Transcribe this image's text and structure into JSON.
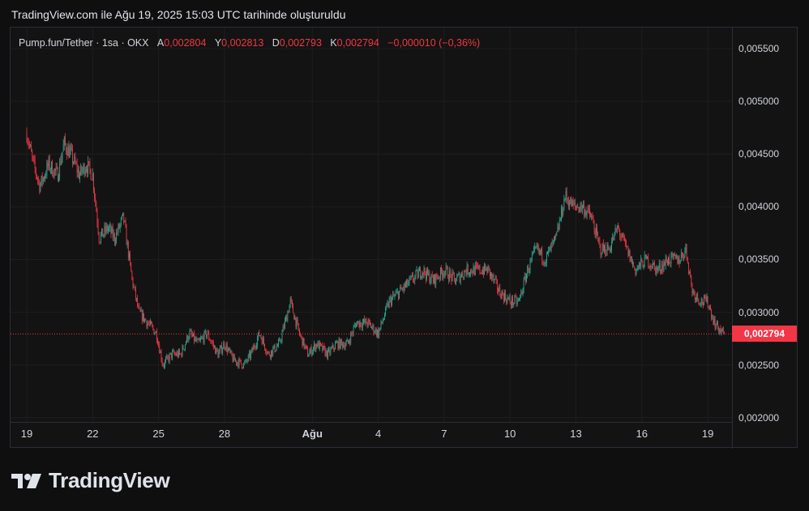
{
  "header": {
    "text": "TradingView.com ile Ağu 19, 2025 15:03 UTC tarihinde oluşturuldu"
  },
  "legend": {
    "symbol": "Pump.fun/Tether · 1sa · OKX",
    "open_label": "A",
    "open": "0,002804",
    "high_label": "Y",
    "high": "0,002813",
    "low_label": "D",
    "low": "0,002793",
    "close_label": "K",
    "close": "0,002794",
    "change": "−0,000010 (−0,36%)"
  },
  "price_tag": "0,002794",
  "logo": {
    "text": "TradingView",
    "icon": "tradingview-logo-icon"
  },
  "colors": {
    "up": "#22ab94",
    "down": "#f23645",
    "background": "#131313",
    "text": "#d1d4dc"
  },
  "chart_data": {
    "type": "candlestick",
    "symbol": "Pump.fun/Tether",
    "interval": "1sa",
    "exchange": "OKX",
    "last_price": 0.002794,
    "ylim": [
      0.00196,
      0.0057
    ],
    "y_ticks": [
      0.0055,
      0.005,
      0.0045,
      0.004,
      0.0035,
      0.003,
      0.0025,
      0.002
    ],
    "y_tick_labels": [
      "0,005500",
      "0,005000",
      "0,004500",
      "0,004000",
      "0,003500",
      "0,003000",
      "0,002500",
      "0,002000"
    ],
    "x_ticks": [
      {
        "label": "19",
        "day": 0,
        "bold": false
      },
      {
        "label": "22",
        "day": 3,
        "bold": false
      },
      {
        "label": "25",
        "day": 6,
        "bold": false
      },
      {
        "label": "28",
        "day": 9,
        "bold": false
      },
      {
        "label": "Ağu",
        "day": 13,
        "bold": true
      },
      {
        "label": "4",
        "day": 16,
        "bold": false
      },
      {
        "label": "7",
        "day": 19,
        "bold": false
      },
      {
        "label": "10",
        "day": 22,
        "bold": false
      },
      {
        "label": "13",
        "day": 25,
        "bold": false
      },
      {
        "label": "16",
        "day": 28,
        "bold": false
      },
      {
        "label": "19",
        "day": 31,
        "bold": false
      }
    ],
    "close_path": [
      [
        0.0,
        0.0047
      ],
      [
        0.3,
        0.0044
      ],
      [
        0.6,
        0.0042
      ],
      [
        1.0,
        0.0044
      ],
      [
        1.4,
        0.0043
      ],
      [
        1.7,
        0.0046
      ],
      [
        2.0,
        0.0045
      ],
      [
        2.4,
        0.0043
      ],
      [
        2.7,
        0.0044
      ],
      [
        3.0,
        0.0043
      ],
      [
        3.3,
        0.0037
      ],
      [
        3.7,
        0.0038
      ],
      [
        4.0,
        0.0037
      ],
      [
        4.4,
        0.0039
      ],
      [
        4.8,
        0.0033
      ],
      [
        5.1,
        0.003
      ],
      [
        5.5,
        0.0029
      ],
      [
        5.9,
        0.0028
      ],
      [
        6.2,
        0.0025
      ],
      [
        6.6,
        0.0026
      ],
      [
        7.0,
        0.0026
      ],
      [
        7.4,
        0.0028
      ],
      [
        7.8,
        0.0027
      ],
      [
        8.2,
        0.0028
      ],
      [
        8.7,
        0.0026
      ],
      [
        9.0,
        0.0027
      ],
      [
        9.4,
        0.00255
      ],
      [
        9.9,
        0.0025
      ],
      [
        10.2,
        0.0026
      ],
      [
        10.6,
        0.0028
      ],
      [
        11.0,
        0.0026
      ],
      [
        11.5,
        0.0027
      ],
      [
        12.0,
        0.0031
      ],
      [
        12.4,
        0.0028
      ],
      [
        12.8,
        0.0026
      ],
      [
        13.2,
        0.0027
      ],
      [
        13.7,
        0.0026
      ],
      [
        14.1,
        0.0027
      ],
      [
        14.6,
        0.0027
      ],
      [
        15.0,
        0.0029
      ],
      [
        15.5,
        0.0029
      ],
      [
        16.0,
        0.0028
      ],
      [
        16.5,
        0.0031
      ],
      [
        17.0,
        0.0032
      ],
      [
        17.5,
        0.0033
      ],
      [
        18.0,
        0.0034
      ],
      [
        18.5,
        0.0033
      ],
      [
        19.0,
        0.0034
      ],
      [
        19.5,
        0.0033
      ],
      [
        20.0,
        0.0034
      ],
      [
        20.5,
        0.0034
      ],
      [
        21.0,
        0.0034
      ],
      [
        21.5,
        0.0032
      ],
      [
        22.0,
        0.0031
      ],
      [
        22.4,
        0.0031
      ],
      [
        22.8,
        0.0034
      ],
      [
        23.2,
        0.0036
      ],
      [
        23.6,
        0.0035
      ],
      [
        24.1,
        0.0037
      ],
      [
        24.5,
        0.0041
      ],
      [
        24.9,
        0.004
      ],
      [
        25.3,
        0.004
      ],
      [
        25.7,
        0.0039
      ],
      [
        26.1,
        0.0036
      ],
      [
        26.5,
        0.0036
      ],
      [
        26.9,
        0.0038
      ],
      [
        27.3,
        0.0036
      ],
      [
        27.7,
        0.0034
      ],
      [
        28.2,
        0.0035
      ],
      [
        28.7,
        0.0034
      ],
      [
        29.2,
        0.0035
      ],
      [
        29.7,
        0.0035
      ],
      [
        30.0,
        0.0036
      ],
      [
        30.3,
        0.0032
      ],
      [
        30.7,
        0.0031
      ],
      [
        31.0,
        0.0031
      ],
      [
        31.3,
        0.0029
      ],
      [
        31.6,
        0.00282
      ],
      [
        31.75,
        0.002794
      ]
    ]
  }
}
